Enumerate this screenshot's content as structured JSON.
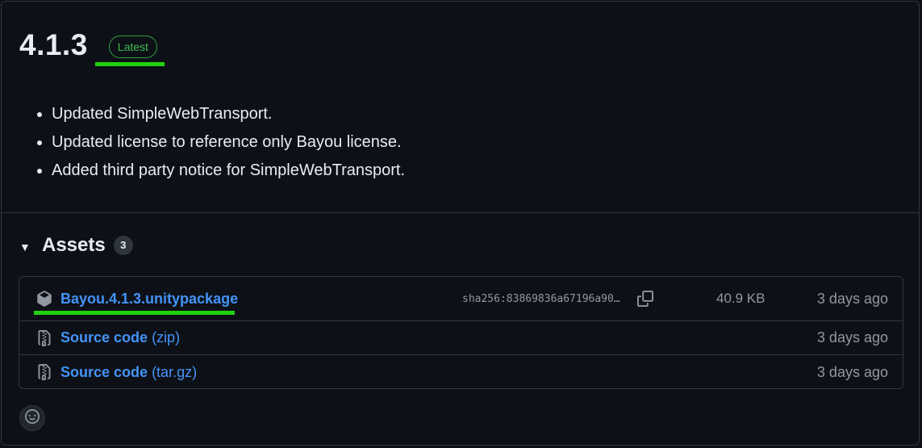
{
  "release": {
    "version": "4.1.3",
    "badge": "Latest",
    "notes": [
      "Updated SimpleWebTransport.",
      "Updated license to reference only Bayou license.",
      "Added third party notice for SimpleWebTransport."
    ]
  },
  "assets": {
    "title": "Assets",
    "count": "3",
    "items": [
      {
        "name": "Bayou.4.1.3.unitypackage",
        "suffix": "",
        "sha": "sha256:83869836a67196a90…",
        "size": "40.9 KB",
        "time": "3 days ago",
        "icon": "package-icon"
      },
      {
        "name": "Source code",
        "suffix": "(zip)",
        "time": "3 days ago",
        "icon": "file-zip-icon"
      },
      {
        "name": "Source code",
        "suffix": "(tar.gz)",
        "time": "3 days ago",
        "icon": "file-zip-icon"
      }
    ]
  },
  "colors": {
    "background": "#0d1117",
    "border": "#30363d",
    "link": "#4493f8",
    "latest_green": "#3fb950",
    "highlight": "#22d20f"
  }
}
